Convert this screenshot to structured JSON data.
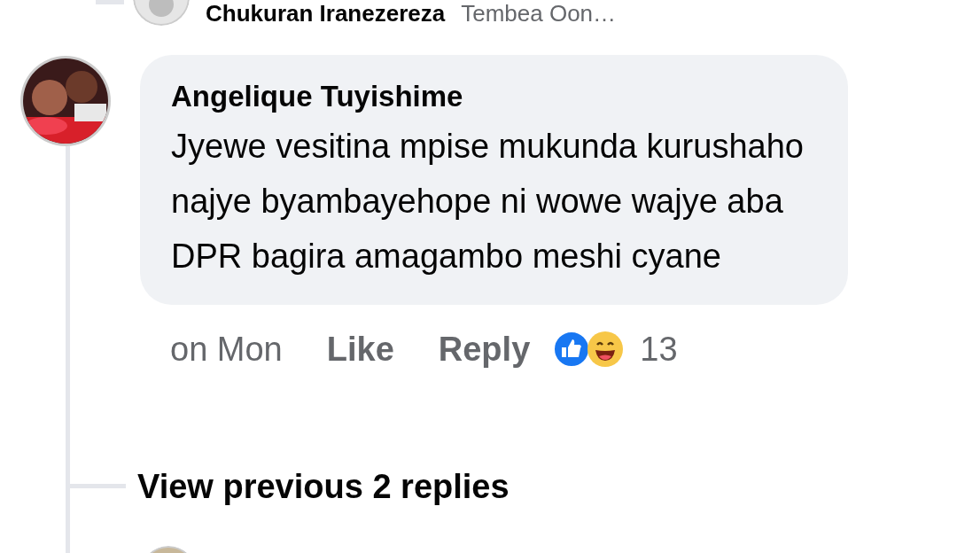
{
  "previous_reply": {
    "author": "Chukuran Iranezereza",
    "text": "Tembea Oon…"
  },
  "comment": {
    "author": "Angelique Tuyishime",
    "text": "Jyewe vesitina mpise mukunda kurushaho najye byambayehope ni wowe wajye aba DPR bagira amagambo meshi cyane",
    "time": "on Mon",
    "actions": [
      "Like",
      "Reply"
    ],
    "reaction_count": "13"
  },
  "view_replies": "View previous 2 replies"
}
